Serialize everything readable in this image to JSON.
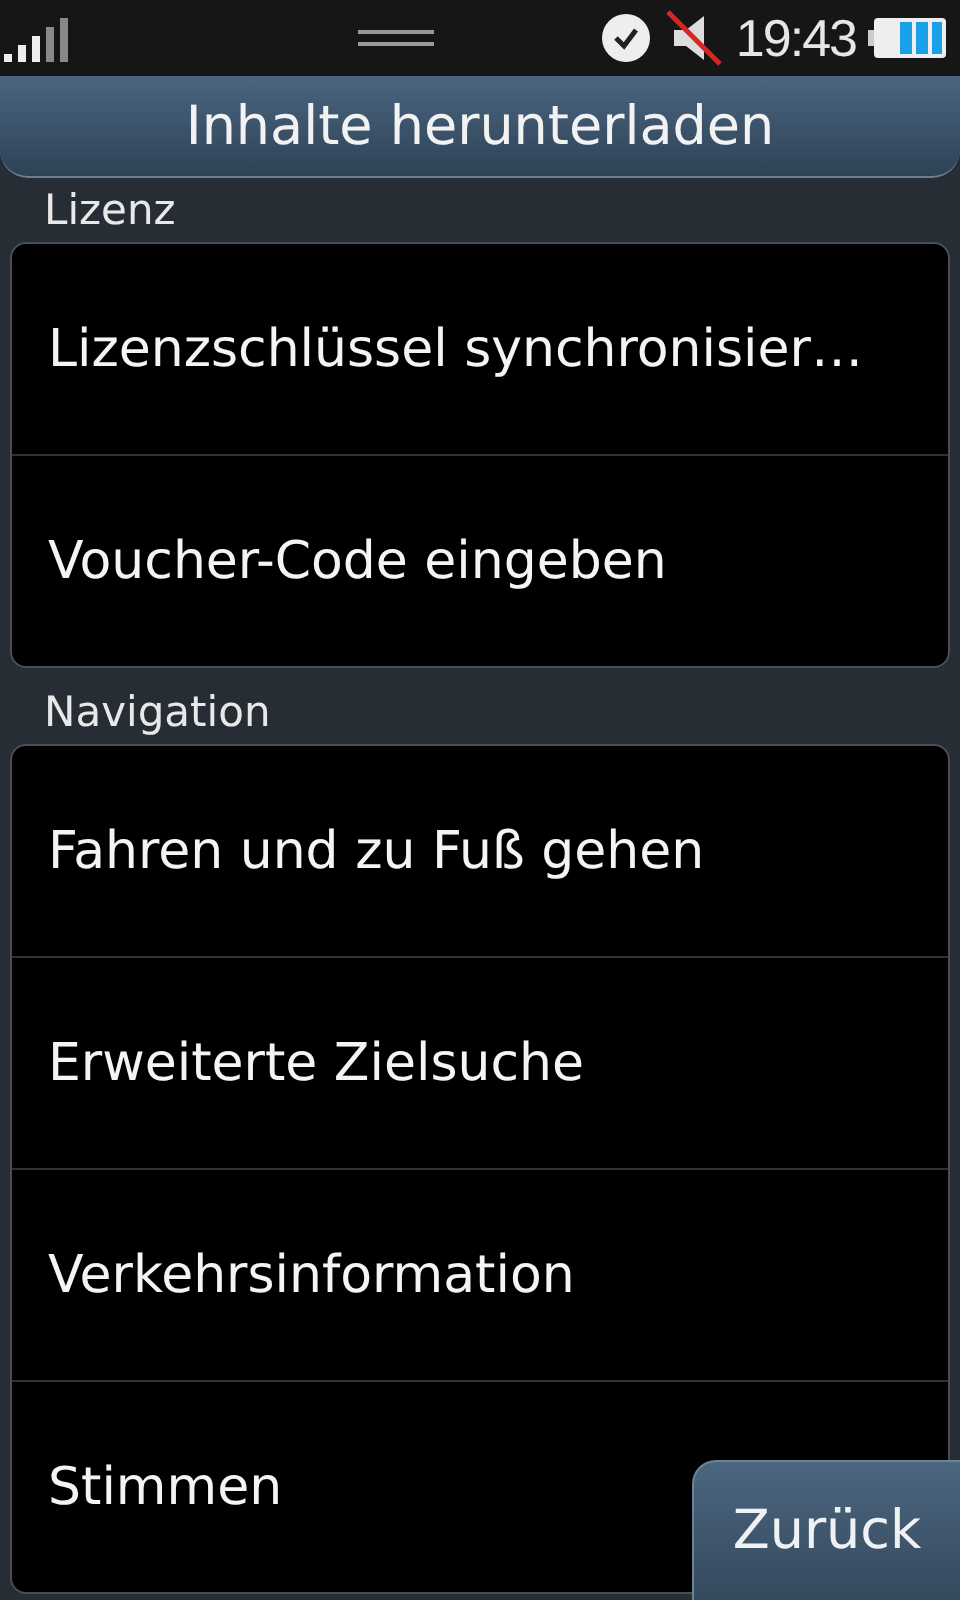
{
  "status_bar": {
    "time": "19:43"
  },
  "title": "Inhalte herunterladen",
  "sections": [
    {
      "header": "Lizenz",
      "items": [
        "Lizenzschlüssel synchronisier…",
        "Voucher-Code eingeben"
      ]
    },
    {
      "header": "Navigation",
      "items": [
        "Fahren und zu Fuß gehen",
        "Erweiterte Zielsuche",
        "Verkehrsinformation",
        "Stimmen"
      ]
    }
  ],
  "back_button": "Zurück"
}
